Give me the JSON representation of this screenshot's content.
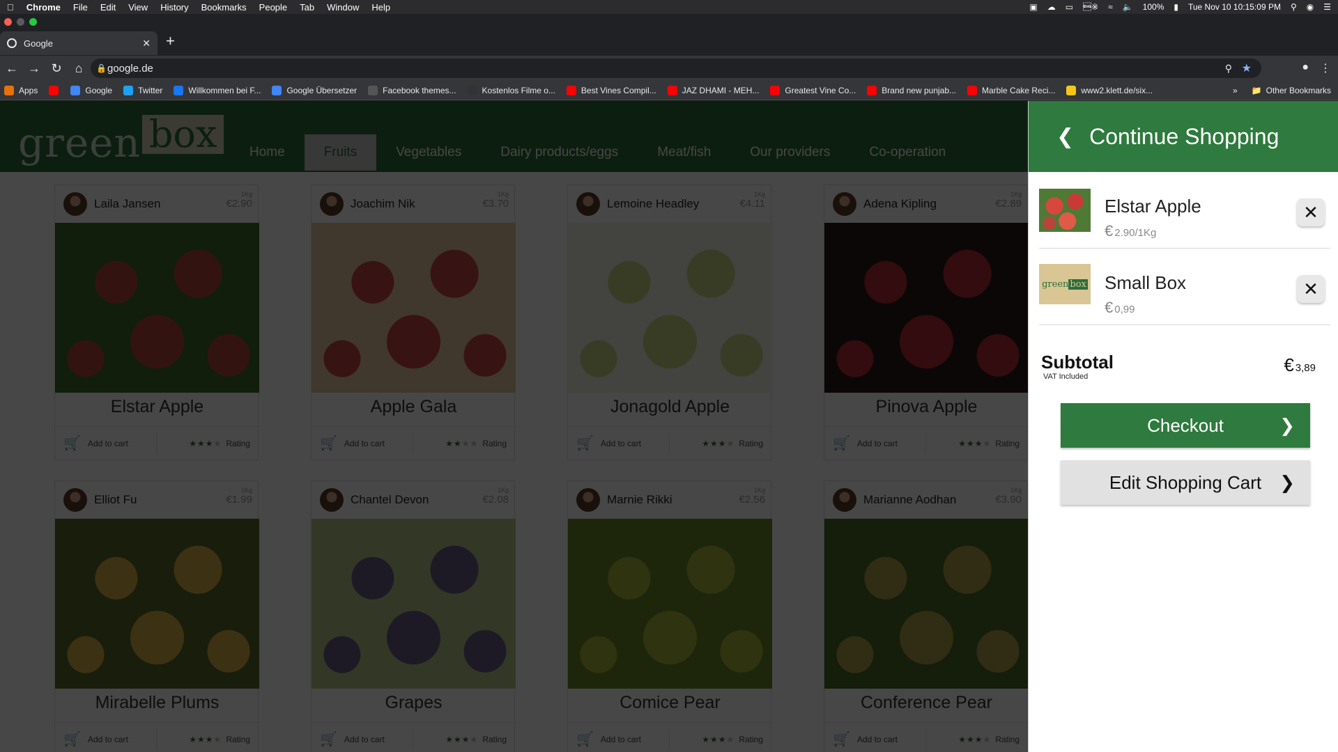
{
  "menubar": {
    "app": "Chrome",
    "items": [
      "File",
      "Edit",
      "View",
      "History",
      "Bookmarks",
      "People",
      "Tab",
      "Window",
      "Help"
    ],
    "battery": "100%",
    "clock": "Tue Nov 10  10:15:09 PM"
  },
  "tab": {
    "title": "Google"
  },
  "address": {
    "url": "google.de"
  },
  "bookmarks": [
    {
      "label": "Apps",
      "icon": "apps-icon",
      "color": "#e8710a"
    },
    {
      "label": "",
      "icon": "youtube-icon",
      "color": "#ff0000"
    },
    {
      "label": "Google",
      "icon": "google-icon",
      "color": "#4285f4"
    },
    {
      "label": "Twitter",
      "icon": "twitter-icon",
      "color": "#1da1f2"
    },
    {
      "label": "Willkommen bei F...",
      "icon": "facebook-icon",
      "color": "#1877f2"
    },
    {
      "label": "Google Übersetzer",
      "icon": "translate-icon",
      "color": "#4285f4"
    },
    {
      "label": "Facebook themes...",
      "icon": "site-icon",
      "color": "#555"
    },
    {
      "label": "Kostenlos Filme o...",
      "icon": "m-icon",
      "color": "#333"
    },
    {
      "label": "Best Vines Compil...",
      "icon": "youtube-icon",
      "color": "#ff0000"
    },
    {
      "label": "JAZ DHAMI - MEH...",
      "icon": "youtube-icon",
      "color": "#ff0000"
    },
    {
      "label": "Greatest Vine Co...",
      "icon": "youtube-icon",
      "color": "#ff0000"
    },
    {
      "label": "Brand new punjab...",
      "icon": "youtube-icon",
      "color": "#ff0000"
    },
    {
      "label": "Marble Cake Reci...",
      "icon": "youtube-icon",
      "color": "#ff0000"
    },
    {
      "label": "www2.klett.de/six...",
      "icon": "klett-icon",
      "color": "#f5c518"
    }
  ],
  "other_bookmarks": "Other Bookmarks",
  "site": {
    "logo_green": "green",
    "logo_box": "box",
    "nav": [
      "Home",
      "Fruits",
      "Vegetables",
      "Dairy products/eggs",
      "Meat/fish",
      "Our providers",
      "Co-operation"
    ],
    "active_nav": "Fruits",
    "add_to_cart": "Add to cart",
    "rating_label": "Rating",
    "unit": "1Kg",
    "products": [
      {
        "seller": "Laila Jansen",
        "price": "€2.90",
        "name": "Elstar Apple",
        "stars": 3,
        "img": "#b8453a",
        "img2": "#3f6b2c"
      },
      {
        "seller": "Joachim Nik",
        "price": "€3.70",
        "name": "Apple Gala",
        "stars": 2,
        "img": "#c9444a",
        "img2": "#e6c9a0"
      },
      {
        "seller": "Lemoine Headley",
        "price": "€4.11",
        "name": "Jonagold Apple",
        "stars": 3,
        "img": "#cbd884",
        "img2": "#f0f0e0"
      },
      {
        "seller": "Adena Kipling",
        "price": "€2.89",
        "name": "Pinova Apple",
        "stars": 3,
        "img": "#b32b35",
        "img2": "#2a1a18"
      },
      {
        "seller": "Elliot Fu",
        "price": "€1.99",
        "name": "Mirabelle Plums",
        "stars": 3,
        "img": "#d8b244",
        "img2": "#5a6a2a"
      },
      {
        "seller": "Chantel Devon",
        "price": "€2.08",
        "name": "Grapes",
        "stars": 3,
        "img": "#6a5f8a",
        "img2": "#b8c98a"
      },
      {
        "seller": "Marnie Rikki",
        "price": "€2.56",
        "name": "Comice Pear",
        "stars": 3,
        "img": "#a8b83c",
        "img2": "#6a8a2a"
      },
      {
        "seller": "Marianne Aodhan",
        "price": "€3.90",
        "name": "Conference Pear",
        "stars": 3,
        "img": "#b0a04a",
        "img2": "#4c6a2a"
      }
    ]
  },
  "panel": {
    "title": "Continue Shopping",
    "items": [
      {
        "name": "Elstar Apple",
        "price": "2.90/1Kg"
      },
      {
        "name": "Small Box",
        "price": "0,99"
      }
    ],
    "subtotal_label": "Subtotal",
    "vat": "VAT Included",
    "subtotal_value": "3,89",
    "currency": "€",
    "checkout": "Checkout",
    "edit_cart": "Edit Shopping Cart"
  }
}
